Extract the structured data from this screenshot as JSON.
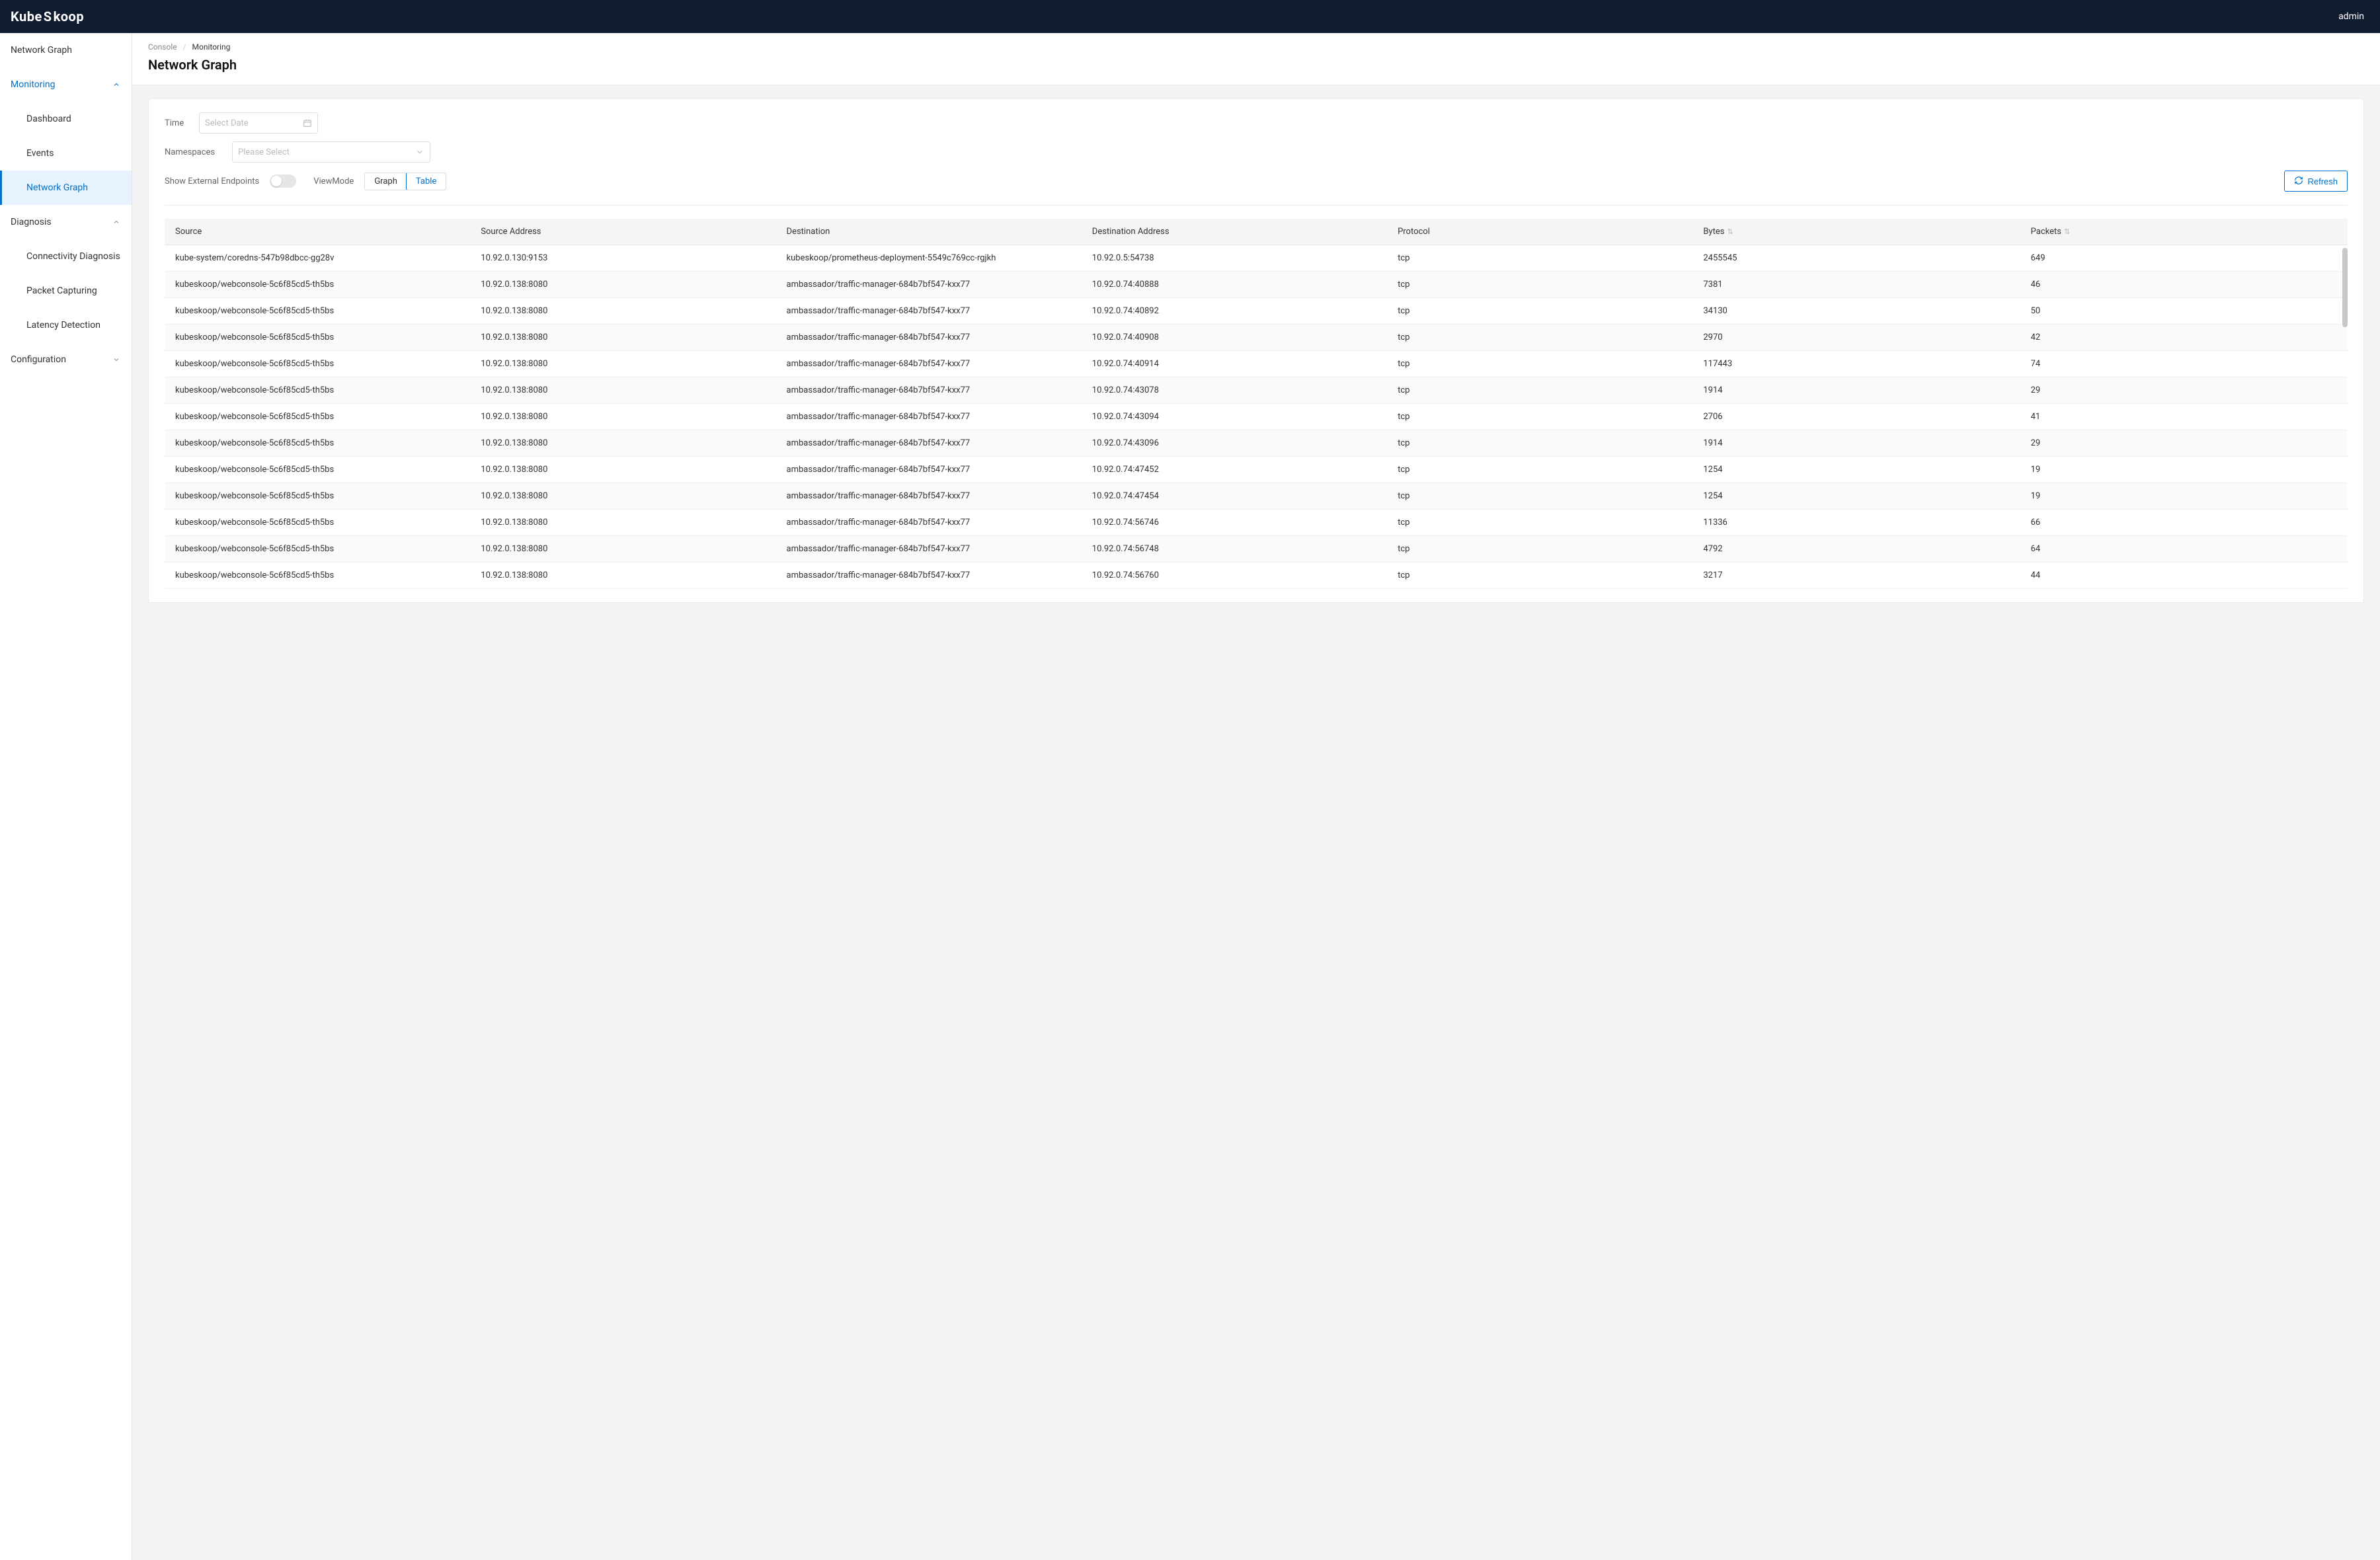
{
  "brand": {
    "text_before_s": "Kube ",
    "s_glyph": "S",
    "text_after_s": "koop"
  },
  "user": {
    "name": "admin"
  },
  "sidebar": {
    "items": [
      {
        "label": "Network Graph",
        "type": "leaf"
      },
      {
        "label": "Monitoring",
        "type": "group",
        "expanded": true,
        "children": [
          {
            "label": "Dashboard"
          },
          {
            "label": "Events"
          },
          {
            "label": "Network Graph",
            "active": true
          }
        ]
      },
      {
        "label": "Diagnosis",
        "type": "group",
        "expanded": true,
        "children": [
          {
            "label": "Connectivity Diagnosis"
          },
          {
            "label": "Packet Capturing"
          },
          {
            "label": "Latency Detection"
          }
        ]
      },
      {
        "label": "Configuration",
        "type": "group",
        "expanded": false
      }
    ]
  },
  "breadcrumb": {
    "root": "Console",
    "sep": "/",
    "current": "Monitoring"
  },
  "page_title": "Network Graph",
  "filters": {
    "time_label": "Time",
    "time_placeholder": "Select Date",
    "ns_label": "Namespaces",
    "ns_placeholder": "Please Select",
    "show_ext_label": "Show External Endpoints",
    "viewmode_label": "ViewMode",
    "viewmode_graph": "Graph",
    "viewmode_table": "Table",
    "refresh_label": "Refresh"
  },
  "table": {
    "columns": {
      "source": "Source",
      "source_addr": "Source Address",
      "dest": "Destination",
      "dest_addr": "Destination Address",
      "protocol": "Protocol",
      "bytes": "Bytes",
      "packets": "Packets"
    },
    "rows": [
      {
        "source": "kube-system/coredns-547b98dbcc-gg28v",
        "source_addr": "10.92.0.130:9153",
        "dest": "kubeskoop/prometheus-deployment-5549c769cc-rgjkh",
        "dest_addr": "10.92.0.5:54738",
        "protocol": "tcp",
        "bytes": "2455545",
        "packets": "649"
      },
      {
        "source": "kubeskoop/webconsole-5c6f85cd5-th5bs",
        "source_addr": "10.92.0.138:8080",
        "dest": "ambassador/traffic-manager-684b7bf547-kxx77",
        "dest_addr": "10.92.0.74:40888",
        "protocol": "tcp",
        "bytes": "7381",
        "packets": "46"
      },
      {
        "source": "kubeskoop/webconsole-5c6f85cd5-th5bs",
        "source_addr": "10.92.0.138:8080",
        "dest": "ambassador/traffic-manager-684b7bf547-kxx77",
        "dest_addr": "10.92.0.74:40892",
        "protocol": "tcp",
        "bytes": "34130",
        "packets": "50"
      },
      {
        "source": "kubeskoop/webconsole-5c6f85cd5-th5bs",
        "source_addr": "10.92.0.138:8080",
        "dest": "ambassador/traffic-manager-684b7bf547-kxx77",
        "dest_addr": "10.92.0.74:40908",
        "protocol": "tcp",
        "bytes": "2970",
        "packets": "42"
      },
      {
        "source": "kubeskoop/webconsole-5c6f85cd5-th5bs",
        "source_addr": "10.92.0.138:8080",
        "dest": "ambassador/traffic-manager-684b7bf547-kxx77",
        "dest_addr": "10.92.0.74:40914",
        "protocol": "tcp",
        "bytes": "117443",
        "packets": "74"
      },
      {
        "source": "kubeskoop/webconsole-5c6f85cd5-th5bs",
        "source_addr": "10.92.0.138:8080",
        "dest": "ambassador/traffic-manager-684b7bf547-kxx77",
        "dest_addr": "10.92.0.74:43078",
        "protocol": "tcp",
        "bytes": "1914",
        "packets": "29"
      },
      {
        "source": "kubeskoop/webconsole-5c6f85cd5-th5bs",
        "source_addr": "10.92.0.138:8080",
        "dest": "ambassador/traffic-manager-684b7bf547-kxx77",
        "dest_addr": "10.92.0.74:43094",
        "protocol": "tcp",
        "bytes": "2706",
        "packets": "41"
      },
      {
        "source": "kubeskoop/webconsole-5c6f85cd5-th5bs",
        "source_addr": "10.92.0.138:8080",
        "dest": "ambassador/traffic-manager-684b7bf547-kxx77",
        "dest_addr": "10.92.0.74:43096",
        "protocol": "tcp",
        "bytes": "1914",
        "packets": "29"
      },
      {
        "source": "kubeskoop/webconsole-5c6f85cd5-th5bs",
        "source_addr": "10.92.0.138:8080",
        "dest": "ambassador/traffic-manager-684b7bf547-kxx77",
        "dest_addr": "10.92.0.74:47452",
        "protocol": "tcp",
        "bytes": "1254",
        "packets": "19"
      },
      {
        "source": "kubeskoop/webconsole-5c6f85cd5-th5bs",
        "source_addr": "10.92.0.138:8080",
        "dest": "ambassador/traffic-manager-684b7bf547-kxx77",
        "dest_addr": "10.92.0.74:47454",
        "protocol": "tcp",
        "bytes": "1254",
        "packets": "19"
      },
      {
        "source": "kubeskoop/webconsole-5c6f85cd5-th5bs",
        "source_addr": "10.92.0.138:8080",
        "dest": "ambassador/traffic-manager-684b7bf547-kxx77",
        "dest_addr": "10.92.0.74:56746",
        "protocol": "tcp",
        "bytes": "11336",
        "packets": "66"
      },
      {
        "source": "kubeskoop/webconsole-5c6f85cd5-th5bs",
        "source_addr": "10.92.0.138:8080",
        "dest": "ambassador/traffic-manager-684b7bf547-kxx77",
        "dest_addr": "10.92.0.74:56748",
        "protocol": "tcp",
        "bytes": "4792",
        "packets": "64"
      },
      {
        "source": "kubeskoop/webconsole-5c6f85cd5-th5bs",
        "source_addr": "10.92.0.138:8080",
        "dest": "ambassador/traffic-manager-684b7bf547-kxx77",
        "dest_addr": "10.92.0.74:56760",
        "protocol": "tcp",
        "bytes": "3217",
        "packets": "44"
      }
    ]
  }
}
